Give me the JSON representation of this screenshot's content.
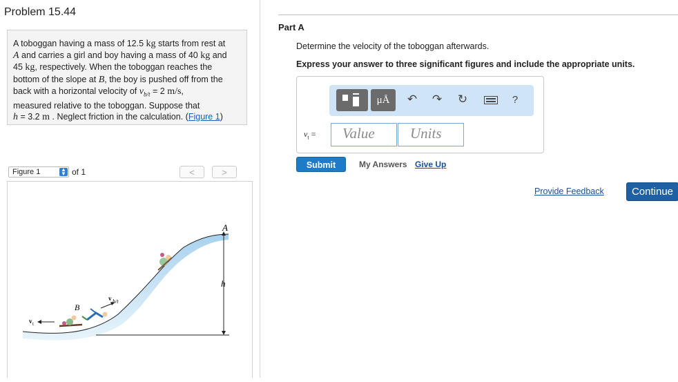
{
  "problem": {
    "title": "Problem 15.44",
    "line1a": "A toboggan having a mass of 12.5",
    "line1b": "kg",
    "line1c": "starts from rest at",
    "line2a": "A",
    "line2b": "and carries a girl and boy having a mass of 40",
    "line2c": "kg",
    "line2d": "and",
    "line3a": "45",
    "line3b": "kg",
    "line3c": ", respectively. When the toboggan reaches the",
    "line4": "bottom of the slope at",
    "line4b": "B",
    "line4c": ", the boy is pushed off from the",
    "line5a": "back with a horizontal velocity of",
    "line5b": "v",
    "line5c": "b/t",
    "line5d": "= 2",
    "line5e": "m/s",
    "line5f": ",",
    "line6": "measured relative to the toboggan. Suppose that",
    "line7a": "h",
    "line7b": "= 3.2",
    "line7c": "m",
    "line7d": ". Neglect friction in the calculation. (",
    "figure_link": "Figure 1",
    "line7e": ")"
  },
  "figure_nav": {
    "select_value": "Figure 1",
    "of_text": "of 1",
    "prev": "<",
    "next": ">"
  },
  "figure_labels": {
    "A": "A",
    "h": "h",
    "B": "B",
    "vbt": "v",
    "vbt_sub": "b/t",
    "vt": "v",
    "vt_sub": "t"
  },
  "part": {
    "label": "Part A",
    "question": "Determine the velocity of the toboggan afterwards.",
    "instruction": "Express your answer to three significant figures and include the appropriate units.",
    "var_label": "v",
    "var_sub": "t",
    "var_eq": "=",
    "value_placeholder": "Value",
    "units_placeholder": "Units",
    "units_tool": "μÅ",
    "help": "?"
  },
  "actions": {
    "submit": "Submit",
    "my_answers": "My Answers",
    "give_up": "Give Up",
    "feedback": "Provide Feedback",
    "continue": "Continue"
  },
  "icons": {
    "undo": "undo-icon",
    "redo": "redo-icon",
    "reset": "reset-icon",
    "keyboard": "keyboard-icon"
  },
  "colors": {
    "accent": "#1e7bc8",
    "continue_bg": "#1f5fa4",
    "toolbar_bg": "#cfe4f7",
    "link": "#1a4f9c"
  }
}
